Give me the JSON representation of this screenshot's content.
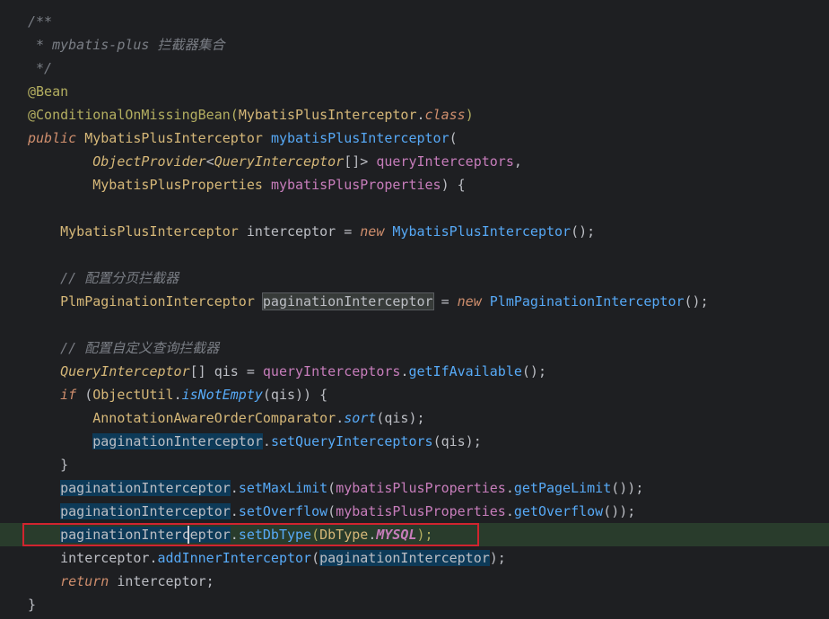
{
  "lines": {
    "l1": {
      "c": "/**"
    },
    "l2": {
      "c": " * mybatis-plus 拦截器集合"
    },
    "l3": {
      "c": " */"
    },
    "l4": {
      "a": "@Bean"
    },
    "l5": {
      "a": "@ConditionalOnMissingBean(",
      "b": "MybatisPlusInterceptor",
      "d": ".",
      "e": "class",
      "f": ")"
    },
    "l6": {
      "kw": "public",
      "s1": " ",
      "cls": "MybatisPlusInterceptor",
      "s2": " ",
      "fn": "mybatisPlusInterceptor",
      "p": "("
    },
    "l7": {
      "ind": "        ",
      "typ": "ObjectProvider",
      "lt": "<",
      "typ2": "QueryInterceptor",
      "br": "[]> ",
      "par": "queryInterceptors",
      "cm": ","
    },
    "l8": {
      "ind": "        ",
      "cls": "MybatisPlusProperties",
      "s": " ",
      "par": "mybatisPlusProperties",
      "tail": ") {"
    },
    "l10": {
      "ind": "    ",
      "cls": "MybatisPlusInterceptor",
      "mid": " interceptor = ",
      "kw": "new",
      "s": " ",
      "cls2": "MybatisPlusInterceptor",
      "tail": "();"
    },
    "l12": {
      "ind": "    ",
      "c": "// 配置分页拦截器"
    },
    "l13": {
      "ind": "    ",
      "cls": "PlmPaginationInterceptor",
      "s": " ",
      "var": "paginationInterceptor",
      "mid": " = ",
      "kw": "new",
      "s2": " ",
      "cls2": "PlmPaginationInterceptor",
      "tail": "();"
    },
    "l15": {
      "ind": "    ",
      "c": "// 配置自定义查询拦截器"
    },
    "l16": {
      "ind": "    ",
      "typ": "QueryInterceptor",
      "mid": "[] qis = ",
      "par": "queryInterceptors",
      "d": ".",
      "m": "getIfAvailable",
      "tail": "();"
    },
    "l17": {
      "ind": "    ",
      "kw": "if",
      "s": " (",
      "cls": "ObjectUtil",
      "d": ".",
      "sm": "isNotEmpty",
      "tail": "(qis)) {"
    },
    "l18": {
      "ind": "        ",
      "cls": "AnnotationAwareOrderComparator",
      "d": ".",
      "sm": "sort",
      "tail": "(qis);"
    },
    "l19": {
      "ind": "        ",
      "var": "paginationInterceptor",
      "d": ".",
      "m": "setQueryInterceptors",
      "tail": "(qis);"
    },
    "l20": {
      "ind": "    ",
      "c": "}"
    },
    "l21": {
      "ind": "    ",
      "var": "paginationInterceptor",
      "d": ".",
      "m": "setMaxLimit",
      "p": "(",
      "par": "mybatisPlusProperties",
      "d2": ".",
      "m2": "getPageLimit",
      "tail": "());"
    },
    "l22": {
      "ind": "    ",
      "var": "paginationInterceptor",
      "d": ".",
      "m": "setOverflow",
      "p": "(",
      "par": "mybatisPlusProperties",
      "d2": ".",
      "m2": "getOverflow",
      "tail": "());"
    },
    "l23": {
      "ind": "    ",
      "var": "paginationInterceptor",
      "d": ".",
      "m": "setDbType",
      "p": "(",
      "cls": "DbType",
      "d2": ".",
      "cst": "MYSQL",
      "tail": ");"
    },
    "l24": {
      "ind": "    ",
      "v": "interceptor",
      "d": ".",
      "m": "addInnerInterceptor",
      "p": "(",
      "var": "paginationInterceptor",
      "tail": ");"
    },
    "l25": {
      "ind": "    ",
      "kw": "return",
      "tail": " interceptor;"
    },
    "l26": {
      "c": "}"
    }
  }
}
